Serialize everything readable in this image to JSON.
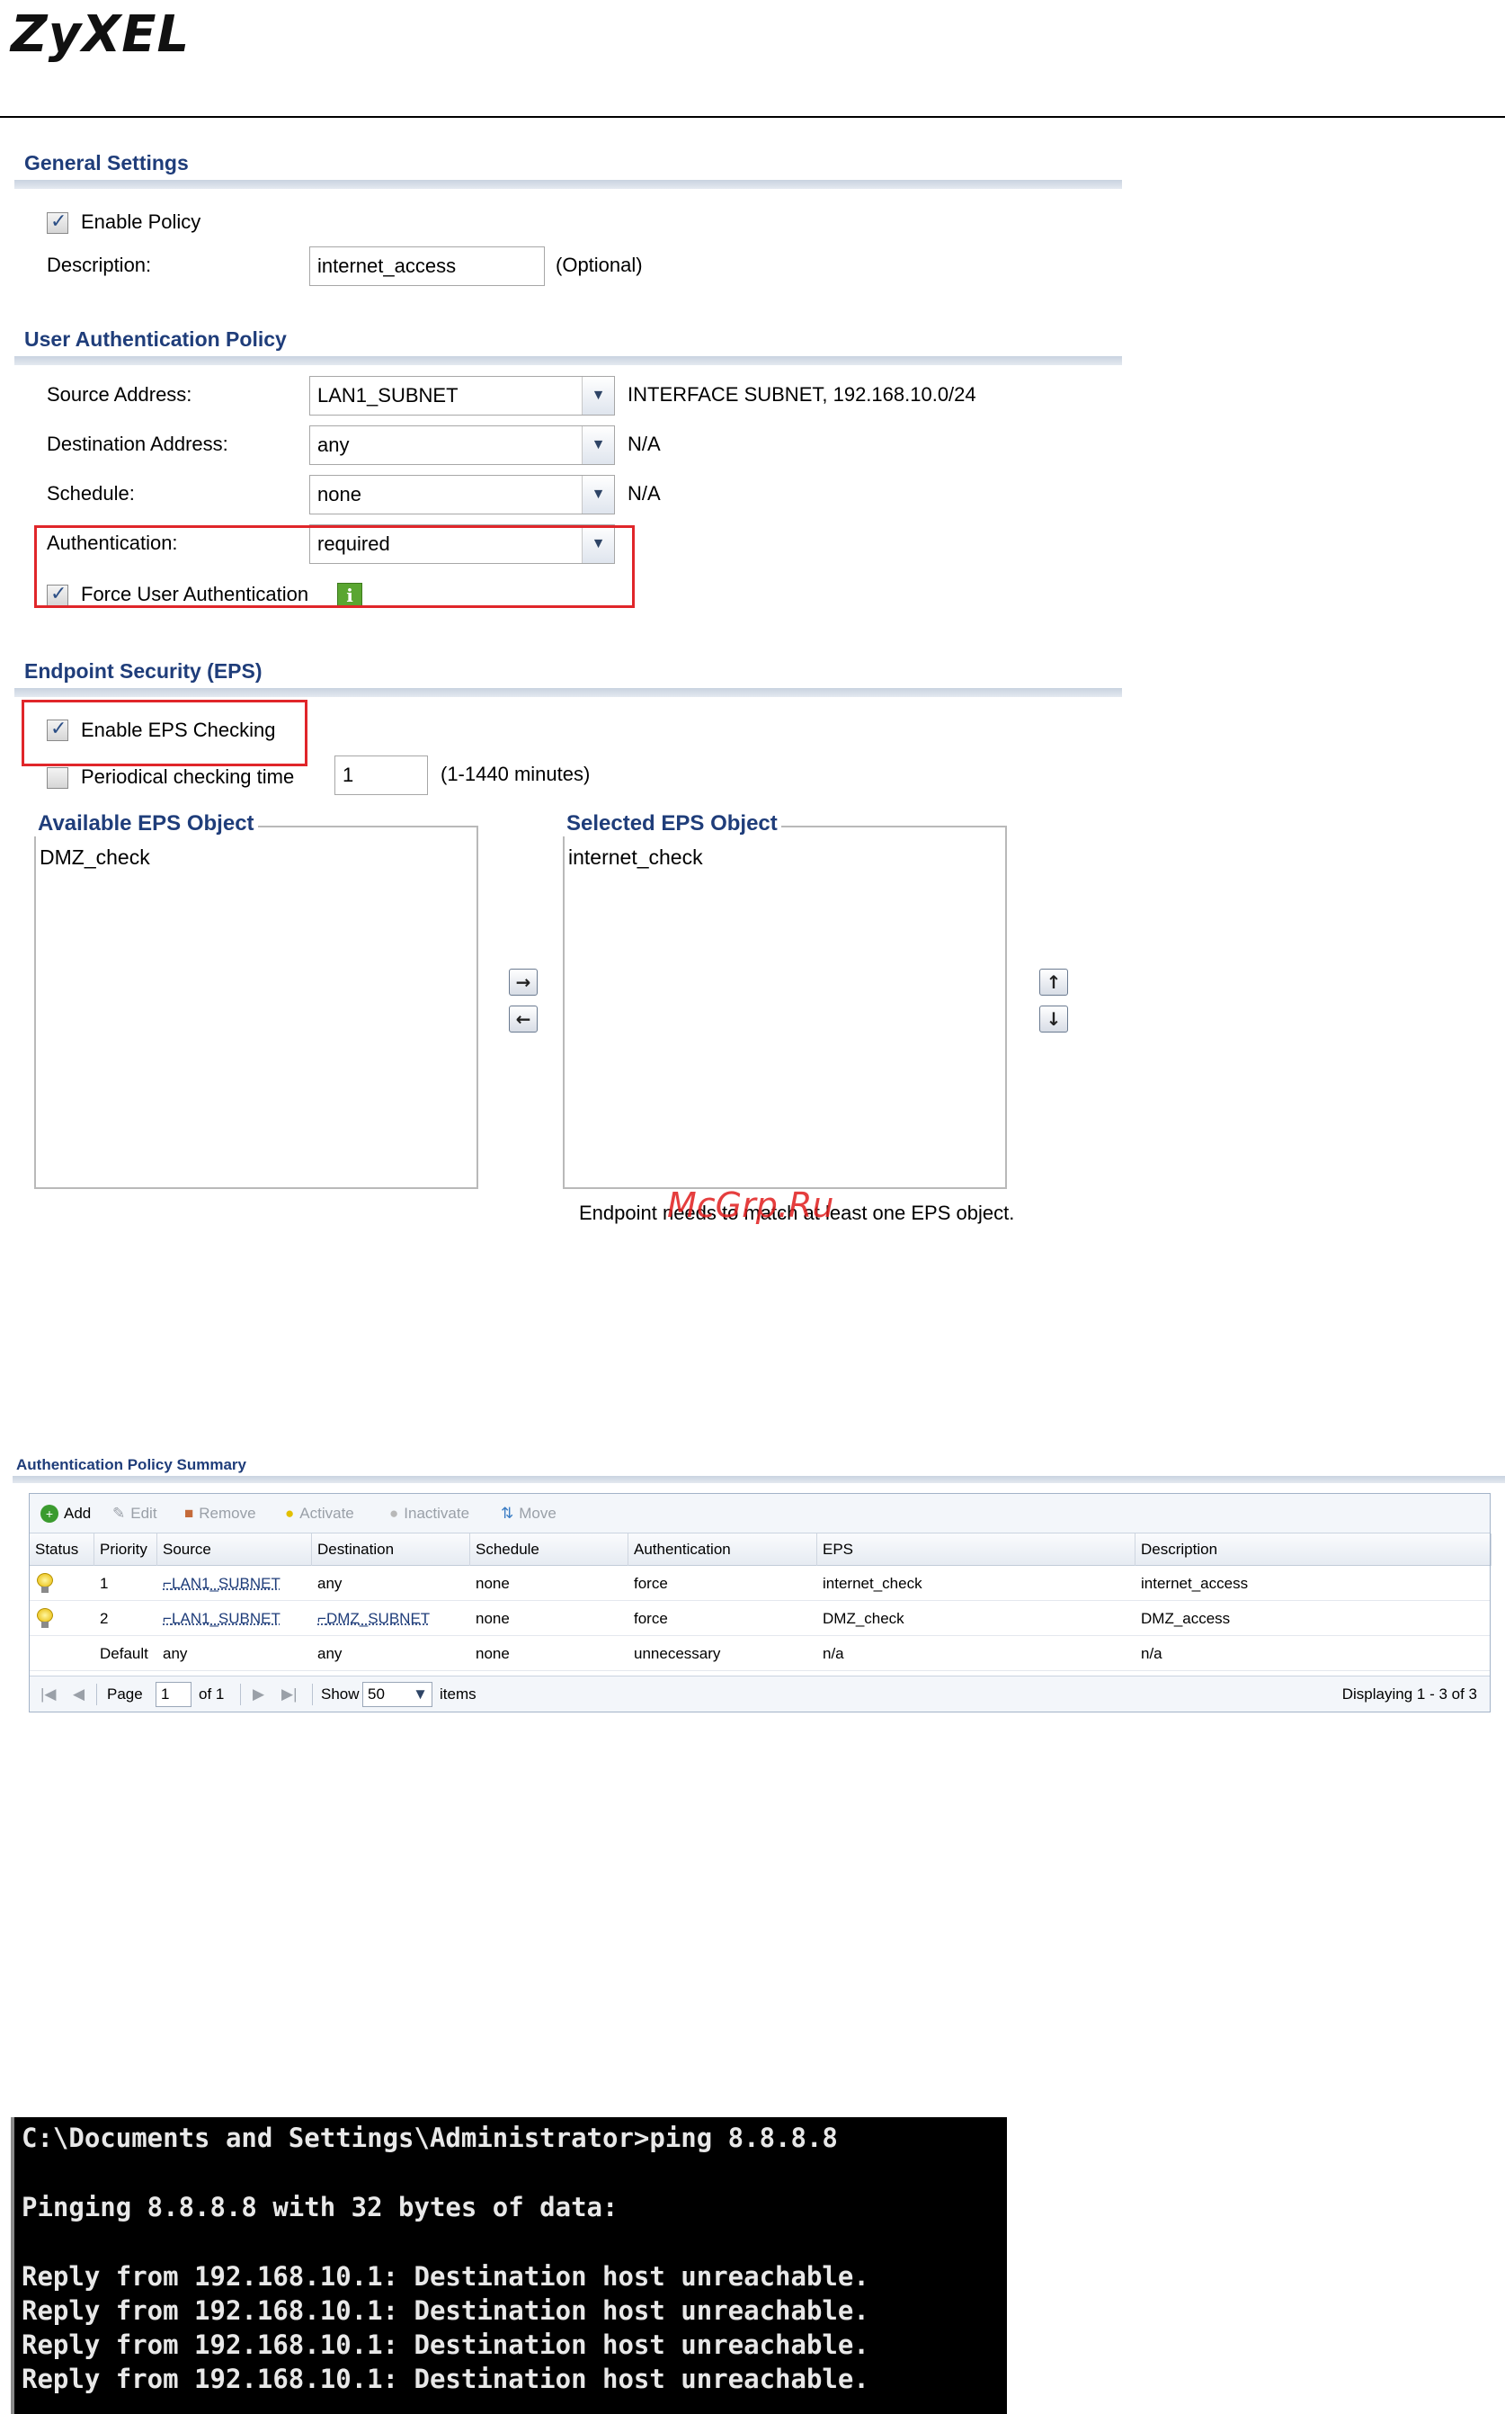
{
  "logo": {
    "text": "ZyXEL"
  },
  "general": {
    "title": "General Settings",
    "enable_policy_label": "Enable Policy",
    "enable_policy_checked": true,
    "description_label": "Description:",
    "description_value": "internet_access",
    "description_hint": "(Optional)"
  },
  "uap": {
    "title": "User Authentication Policy",
    "source_label": "Source Address:",
    "source_value": "LAN1_SUBNET",
    "source_info": "INTERFACE SUBNET, 192.168.10.0/24",
    "dest_label": "Destination Address:",
    "dest_value": "any",
    "dest_info": "N/A",
    "schedule_label": "Schedule:",
    "schedule_value": "none",
    "schedule_info": "N/A",
    "auth_label": "Authentication:",
    "auth_value": "required",
    "force_label": "Force User Authentication",
    "force_checked": true
  },
  "eps": {
    "title": "Endpoint Security (EPS)",
    "enable_label": "Enable EPS Checking",
    "enable_checked": true,
    "periodical_label": "Periodical checking time",
    "periodical_checked": false,
    "periodical_value": "1",
    "periodical_hint": "(1-1440 minutes)",
    "available_title": "Available EPS Object",
    "available_items": [
      "DMZ_check"
    ],
    "selected_title": "Selected EPS Object",
    "selected_items": [
      "internet_check"
    ],
    "note": "Endpoint needs to match at least one EPS object."
  },
  "watermark": "McGrp.Ru",
  "summary": {
    "title": "Authentication Policy Summary",
    "toolbar": {
      "add": "Add",
      "edit": "Edit",
      "remove": "Remove",
      "activate": "Activate",
      "inactivate": "Inactivate",
      "move": "Move"
    },
    "columns": [
      "Status",
      "Priority",
      "Source",
      "Destination",
      "Schedule",
      "Authentication",
      "EPS",
      "Description"
    ],
    "rows": [
      {
        "status": "active",
        "priority": "1",
        "source": "LAN1_SUBNET",
        "destination": "any",
        "schedule": "none",
        "authentication": "force",
        "eps": "internet_check",
        "description": "internet_access"
      },
      {
        "status": "active",
        "priority": "2",
        "source": "LAN1_SUBNET",
        "destination": "DMZ_SUBNET",
        "schedule": "none",
        "authentication": "force",
        "eps": "DMZ_check",
        "description": "DMZ_access"
      },
      {
        "status": "",
        "priority": "Default",
        "source": "any",
        "destination": "any",
        "schedule": "none",
        "authentication": "unnecessary",
        "eps": "n/a",
        "description": "n/a"
      }
    ],
    "pager": {
      "page_label": "Page",
      "page_value": "1",
      "of_label": "of 1",
      "show_label": "Show",
      "show_value": "50",
      "items_label": "items",
      "displaying": "Displaying 1 - 3 of 3"
    }
  },
  "console": {
    "lines": [
      "C:\\Documents and Settings\\Administrator>ping 8.8.8.8",
      "Pinging 8.8.8.8 with 32 bytes of data:",
      "Reply from 192.168.10.1: Destination host unreachable.",
      "Reply from 192.168.10.1: Destination host unreachable.",
      "Reply from 192.168.10.1: Destination host unreachable.",
      "Reply from 192.168.10.1: Destination host unreachable."
    ]
  }
}
